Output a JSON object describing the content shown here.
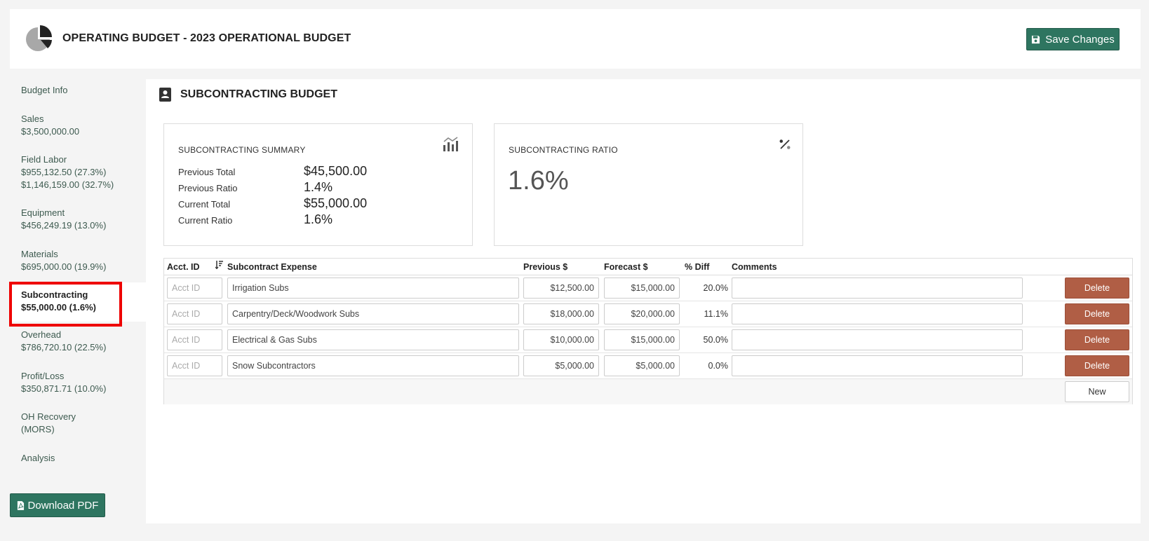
{
  "header": {
    "title": "OPERATING BUDGET - 2023 OPERATIONAL BUDGET",
    "save_label": "Save Changes",
    "logo_icon": "pie-chart-icon",
    "save_icon": "floppy-disk-icon"
  },
  "sidebar": {
    "items": [
      {
        "label": "Budget Info",
        "values": []
      },
      {
        "label": "Sales",
        "values": [
          "$3,500,000.00"
        ]
      },
      {
        "label": "Field Labor",
        "values": [
          "$955,132.50 (27.3%)",
          "$1,146,159.00 (32.7%)"
        ]
      },
      {
        "label": "Equipment",
        "values": [
          "$456,249.19 (13.0%)"
        ]
      },
      {
        "label": "Materials",
        "values": [
          "$695,000.00 (19.9%)"
        ]
      },
      {
        "label": "Subcontracting",
        "values": [
          "$55,000.00 (1.6%)"
        ],
        "active": true
      },
      {
        "label": "Overhead",
        "values": [
          "$786,720.10 (22.5%)"
        ]
      },
      {
        "label": "Profit/Loss",
        "values": [
          "$350,871.71 (10.0%)"
        ]
      },
      {
        "label": "OH Recovery",
        "values": [
          "(MORS)"
        ]
      },
      {
        "label": "Analysis",
        "values": []
      }
    ],
    "download_label": "Download PDF",
    "download_icon": "pdf-file-icon"
  },
  "section": {
    "title": "SUBCONTRACTING BUDGET",
    "icon": "contact-book-icon"
  },
  "summary_card": {
    "title": "SUBCONTRACTING SUMMARY",
    "icon": "bar-chart-icon",
    "rows": [
      {
        "label": "Previous Total",
        "value": "$45,500.00"
      },
      {
        "label": "Previous Ratio",
        "value": "1.4%"
      },
      {
        "label": "Current Total",
        "value": "$55,000.00"
      },
      {
        "label": "Current Ratio",
        "value": "1.6%"
      }
    ]
  },
  "ratio_card": {
    "title": "SUBCONTRACTING RATIO",
    "icon": "percent-icon",
    "value": "1.6%"
  },
  "table": {
    "columns": {
      "acct": "Acct. ID",
      "expense": "Subcontract Expense",
      "previous": "Previous $",
      "forecast": "Forecast $",
      "diff": "% Diff",
      "comments": "Comments"
    },
    "acct_placeholder": "Acct ID",
    "delete_label": "Delete",
    "new_label": "New",
    "rows": [
      {
        "expense": "Irrigation Subs",
        "previous": "$12,500.00",
        "forecast": "$15,000.00",
        "diff": "20.0%"
      },
      {
        "expense": "Carpentry/Deck/Woodwork Subs",
        "previous": "$18,000.00",
        "forecast": "$20,000.00",
        "diff": "11.1%"
      },
      {
        "expense": "Electrical & Gas Subs",
        "previous": "$10,000.00",
        "forecast": "$15,000.00",
        "diff": "50.0%"
      },
      {
        "expense": "Snow Subcontractors",
        "previous": "$5,000.00",
        "forecast": "$5,000.00",
        "diff": "0.0%"
      }
    ]
  }
}
